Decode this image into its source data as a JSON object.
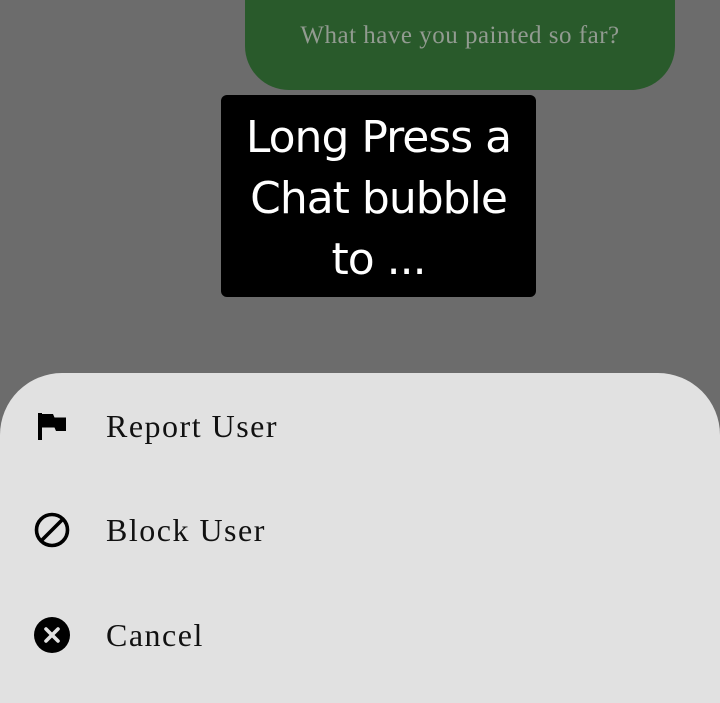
{
  "chat": {
    "bubble_text": "What have you painted so far?",
    "bubble_color": "#295a2b"
  },
  "tooltip": {
    "lines": [
      "Long Press a",
      "Chat bubble",
      "to ..."
    ]
  },
  "sheet": {
    "items": [
      {
        "label": "Report User",
        "icon": "flag-icon"
      },
      {
        "label": "Block User",
        "icon": "block-icon"
      },
      {
        "label": "Cancel",
        "icon": "cancel-icon"
      }
    ]
  },
  "colors": {
    "overlay": "#6c6c6c",
    "sheet_background": "#e1e1e1",
    "tooltip_background": "#000000"
  }
}
